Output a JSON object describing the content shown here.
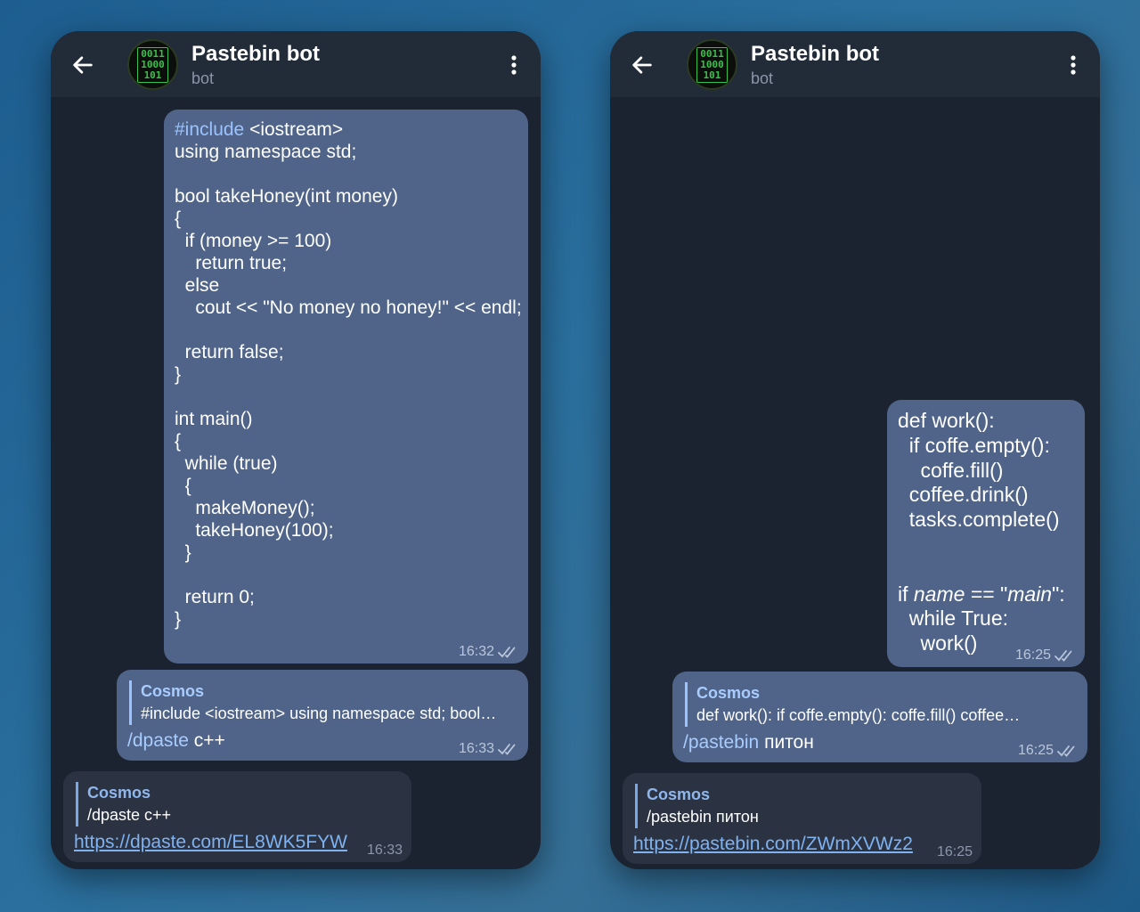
{
  "chat": {
    "title": "Pastebin bot",
    "subtitle": "bot",
    "avatar_text": "0011\n1000\n101"
  },
  "left": {
    "code_prefix": "#include",
    "code_first_rest": " <iostream>",
    "code_rest": "\nusing namespace std;\n\nbool takeHoney(int money)\n{\n  if (money >= 100)\n    return true;\n  else\n    cout << \"No money no honey!\" << endl;\n\n  return false;\n}\n\nint main()\n{\n  while (true)\n  {\n    makeMoney();\n    takeHoney(100);\n  }\n\n  return 0;\n}",
    "code_time": "16:32",
    "reply_name": "Cosmos",
    "reply_text": "#include <iostream>  using namespace std;  bool…",
    "command": "/dpaste",
    "command_arg": " c++",
    "reply_time": "16:33",
    "bot_quote_name": "Cosmos",
    "bot_quote_text": "/dpaste c++",
    "bot_link": "https://dpaste.com/EL8WK5FYW",
    "bot_time": "16:33"
  },
  "right": {
    "code_a": "def work():\n  if coffe.empty():\n    coffe.fill()\n  coffee.drink()\n  tasks.complete()\n\n\nif ",
    "code_name": "name",
    "code_b": " == \"",
    "code_main": "main",
    "code_c": "\":\n  while True:\n    work()",
    "code_time": "16:25",
    "reply_name": "Cosmos",
    "reply_text": "def work():   if coffe.empty():     coffe.fill()   coffee…",
    "command": "/pastebin",
    "command_arg": " питон",
    "reply_time": "16:25",
    "bot_quote_name": "Cosmos",
    "bot_quote_text": "/pastebin питон",
    "bot_link": "https://pastebin.com/ZWmXVWz2",
    "bot_time": "16:25"
  },
  "colors": {
    "outgoing_bubble": "#4f6488",
    "incoming_bubble": "#2b3343",
    "chat_background": "#1c2330",
    "header": "#222b38",
    "link": "#7fb2f0",
    "accent": "#9cc3ff"
  },
  "icons": {
    "back": "arrow-left-icon",
    "menu": "more-vertical-icon",
    "read": "double-check-icon"
  }
}
